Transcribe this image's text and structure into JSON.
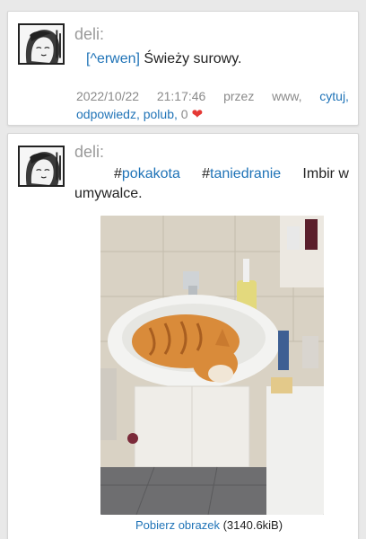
{
  "posts": [
    {
      "author": "deli:",
      "mention": "[^erwen]",
      "text": " Świeży surowy.",
      "meta": {
        "date": "2022/10/22",
        "time": "21:17:46",
        "via_label": "przez",
        "client": "www,",
        "actions": {
          "quote": "cytuj,",
          "reply": "odpowiedz,",
          "like": "polub,",
          "like_count": "0"
        }
      }
    },
    {
      "author": "deli:",
      "tags": [
        "#pokakota",
        "#taniedranie"
      ],
      "text_part1": "Imbir w",
      "text_part2": "umywalce.",
      "attachment": {
        "download_label": "Pobierz obrazek",
        "size": "(3140.6kiB)"
      }
    }
  ],
  "colors": {
    "link": "#1f73b7",
    "heart": "#e53935",
    "muted": "#8a8a8a"
  },
  "icons": {
    "heart": "❤"
  }
}
